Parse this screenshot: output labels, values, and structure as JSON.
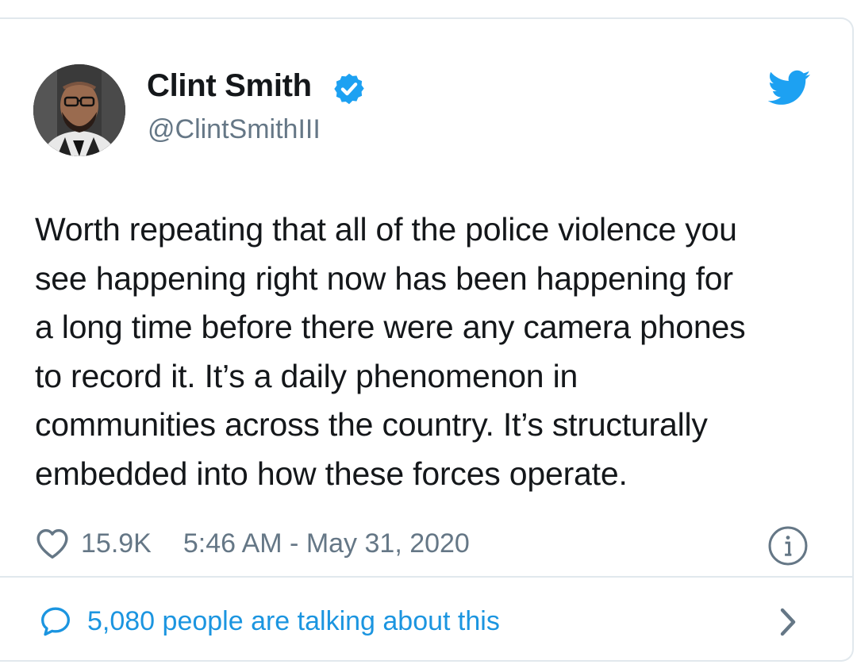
{
  "author": {
    "name": "Clint Smith",
    "handle": "@ClintSmithIII",
    "verified": true
  },
  "tweet": {
    "lines": [
      "Worth repeating that all of the police violence you",
      "see happening right now has been happening for",
      "a long time before there were any camera phones",
      "to record it. It’s a daily phenomenon in",
      "communities across the country. It’s structurally",
      "embedded into how these forces operate."
    ]
  },
  "meta": {
    "likes": "15.9K",
    "timestamp": "5:46 AM - May 31, 2020"
  },
  "footer": {
    "talking": "5,080 people are talking about this"
  },
  "icons": {
    "brand": "twitter-bird-icon",
    "verified": "verified-badge-icon",
    "like": "heart-icon",
    "info": "info-icon",
    "reply": "speech-bubble-icon",
    "more": "chevron-right-icon"
  },
  "colors": {
    "twitter_blue": "#1da1f2",
    "link_blue": "#1b95e0",
    "text": "#14171a",
    "secondary": "#657786",
    "border": "#e1e8ed"
  }
}
